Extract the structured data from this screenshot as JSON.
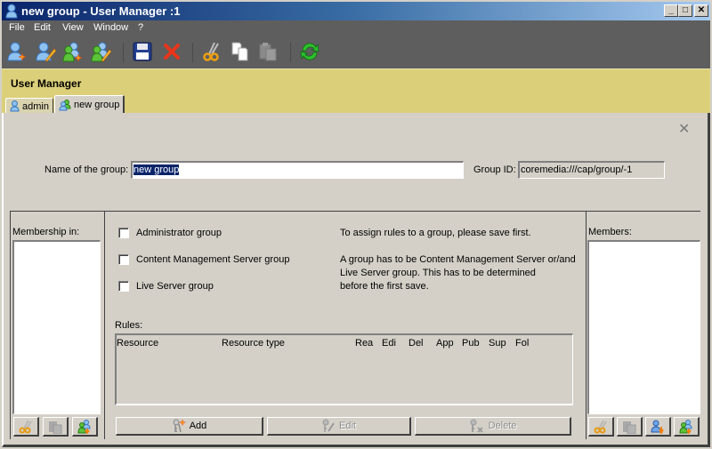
{
  "window": {
    "title": "new group - User Manager :1",
    "controls": {
      "minimize": "_",
      "maximize": "□",
      "close": "✕"
    }
  },
  "menu": [
    "File",
    "Edit",
    "View",
    "Window",
    "?"
  ],
  "toolbar": {
    "buttons": [
      {
        "name": "new-user",
        "icon": "user-new-icon"
      },
      {
        "name": "edit-user",
        "icon": "user-edit-icon"
      },
      {
        "name": "new-group",
        "icon": "group-new-icon"
      },
      {
        "name": "edit-group",
        "icon": "group-edit-icon"
      },
      {
        "name": "save",
        "icon": "save-icon"
      },
      {
        "name": "delete",
        "icon": "delete-icon"
      },
      {
        "name": "cut",
        "icon": "cut-icon"
      },
      {
        "name": "copy",
        "icon": "copy-icon"
      },
      {
        "name": "paste",
        "icon": "paste-icon",
        "disabled": true
      },
      {
        "name": "refresh",
        "icon": "refresh-icon"
      }
    ]
  },
  "header": {
    "title": "User Manager"
  },
  "tabs": [
    {
      "label": "admin",
      "icon": "user-icon",
      "active": false
    },
    {
      "label": "new group",
      "icon": "group-icon",
      "active": true
    }
  ],
  "form": {
    "name_label": "Name of the group:",
    "name_value": "new group",
    "group_id_label": "Group ID:",
    "group_id_value": "coremedia:///cap/group/-1"
  },
  "membership": {
    "label": "Membership in:",
    "items": []
  },
  "members": {
    "label": "Members:",
    "items": []
  },
  "checkboxes": [
    {
      "label": "Administrator group",
      "checked": false
    },
    {
      "label": "Content Management Server group",
      "checked": false
    },
    {
      "label": "Live Server group",
      "checked": false
    }
  ],
  "info": {
    "line1": "To assign rules to a group, please save first.",
    "line2a": "A group has to be Content Management Server or/and",
    "line2b": "Live Server group. This has to be determined",
    "line2c": "before the first save."
  },
  "rules": {
    "label": "Rules:",
    "columns": [
      "Resource",
      "Resource type",
      "Rea",
      "Edi",
      "Del",
      "App",
      "Pub",
      "Sup",
      "Fol"
    ],
    "rows": []
  },
  "rule_buttons": {
    "add": "Add",
    "edit": "Edit",
    "delete": "Delete"
  },
  "colors": {
    "title_gradient_start": "#0a246a",
    "title_gradient_end": "#a6caf0",
    "toolbar_bg": "#5e5e5e",
    "header_bg": "#dccf7a",
    "panel_bg": "#d4d0c8",
    "selection": "#0a246a"
  }
}
